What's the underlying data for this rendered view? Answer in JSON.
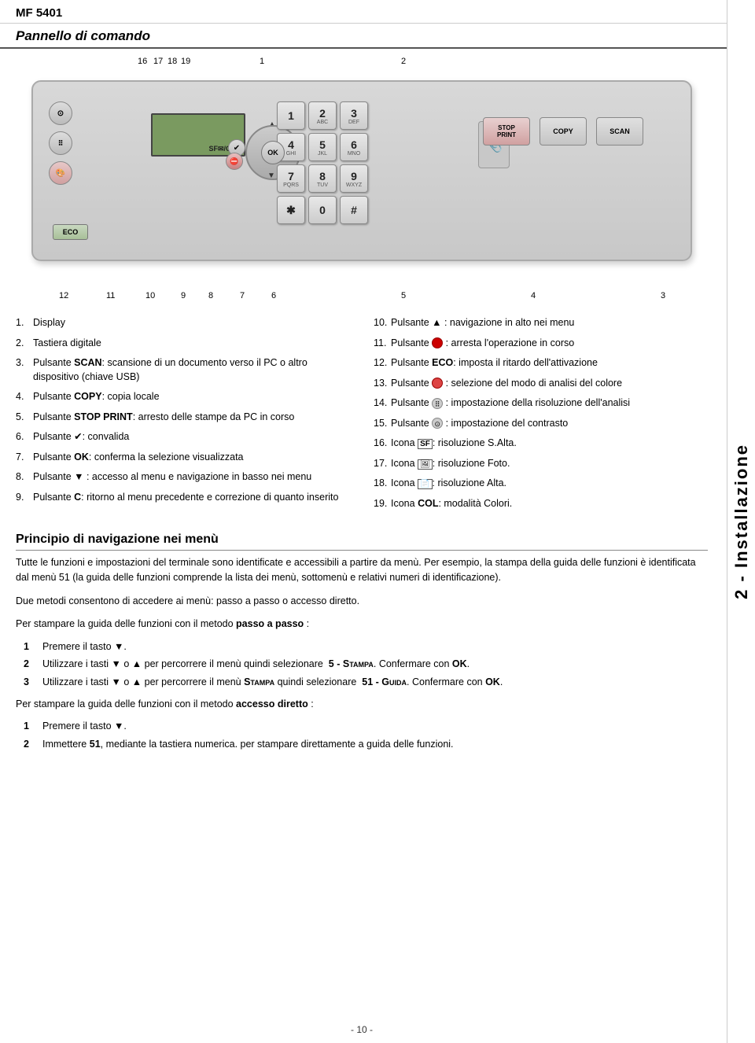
{
  "header": {
    "model": "MF 5401"
  },
  "side_label": {
    "text": "2 - Installazione"
  },
  "section1": {
    "title": "Pannello di comando"
  },
  "panel": {
    "position_numbers_top": [
      "16",
      "17",
      "18",
      "19",
      "1",
      "2"
    ],
    "position_numbers_bottom": [
      "12",
      "11",
      "10",
      "9",
      "8",
      "7",
      "6",
      "5",
      "4",
      "3"
    ],
    "lcd_text": "SF✉/COL",
    "keys": [
      {
        "label": "1",
        "sub": ""
      },
      {
        "label": "2",
        "sub": "ABC"
      },
      {
        "label": "3",
        "sub": "DEF"
      },
      {
        "label": "4",
        "sub": "GHI"
      },
      {
        "label": "5",
        "sub": "JKL"
      },
      {
        "label": "6",
        "sub": "MNO"
      },
      {
        "label": "7",
        "sub": "PQRS"
      },
      {
        "label": "8",
        "sub": "TUV"
      },
      {
        "label": "9",
        "sub": "WXYZ"
      },
      {
        "label": "✱",
        "sub": ""
      },
      {
        "label": "0",
        "sub": ""
      },
      {
        "label": "#",
        "sub": ""
      }
    ],
    "func_buttons": [
      {
        "label": "STOP\nPRINT",
        "type": "stop"
      },
      {
        "label": "COPY",
        "type": "normal"
      },
      {
        "label": "SCAN",
        "type": "normal"
      }
    ],
    "eco_label": "ECO"
  },
  "items_left": [
    {
      "num": "1.",
      "text": "Display"
    },
    {
      "num": "2.",
      "text": "Tastiera digitale"
    },
    {
      "num": "3.",
      "text": "Pulsante <b>SCAN</b>: scansione di un documento verso il PC o altro dispositivo (chiave USB)"
    },
    {
      "num": "4.",
      "text": "Pulsante <b>COPY</b>: copia locale"
    },
    {
      "num": "5.",
      "text": "Pulsante <b>STOP PRINT</b>: arresto delle stampe da PC in corso"
    },
    {
      "num": "6.",
      "text": "Pulsante ✔: convalida"
    },
    {
      "num": "7.",
      "text": "Pulsante <b>OK</b>: conferma la selezione visualizzata"
    },
    {
      "num": "8.",
      "text": "Pulsante ▼ : accesso al menu e navigazione in basso nei menu"
    },
    {
      "num": "9.",
      "text": "Pulsante <b>C</b>: ritorno al menu precedente e correzione di quanto inserito"
    }
  ],
  "items_right": [
    {
      "num": "10.",
      "text": "Pulsante ▲ : navigazione in alto nei menu"
    },
    {
      "num": "11.",
      "text": "Pulsante 🔴 : arresta l'operazione in corso"
    },
    {
      "num": "12.",
      "text": "Pulsante <b>ECO</b>: imposta il ritardo dell'attivazione"
    },
    {
      "num": "13.",
      "text": "Pulsante 🎨 : selezione del modo di analisi del colore"
    },
    {
      "num": "14.",
      "text": "Pulsante ⠿ : impostazione della risoluzione dell'analisi"
    },
    {
      "num": "15.",
      "text": "Pulsante ⊙ : impostazione del contrasto"
    },
    {
      "num": "16.",
      "text": "Icona 📷: risoluzione S.Alta."
    },
    {
      "num": "17.",
      "text": "Icona 🖼: risoluzione Foto."
    },
    {
      "num": "18.",
      "text": "Icona 📄: risoluzione Alta."
    },
    {
      "num": "19.",
      "text": "Icona COL: modalità Colori."
    }
  ],
  "section2": {
    "title": "Principio di navigazione nei menù",
    "intro": "Tutte le funzioni e impostazioni del terminale sono identificate e accessibili a partire da menù. Per esempio, la stampa della guida delle funzioni è identificata dal menù 51 (la guida delle funzioni comprende la lista dei menù, sottomenù e relativi numeri di identificazione).",
    "para2": "Due metodi consentono di accedere ai menù: passo a passo o accesso diretto.",
    "passo_intro": "Per stampare la guida delle funzioni con il metodo",
    "passo_bold": "passo a passo",
    "passo_colon": " :",
    "steps_passo": [
      {
        "num": "1",
        "text": "Premere il tasto ▼."
      },
      {
        "num": "2",
        "text": "Utilizzare i tasti ▼ o ▲ per percorrere il menù quindi selezionare  <b>5 - Stampa</b>. Confermare con <b>OK</b>."
      },
      {
        "num": "3",
        "text": "Utilizzare i tasti ▼ o ▲ per percorrere il menù <b>Stampa</b> quindi selezionare  <b>51 - Guida</b>. Confermare con <b>OK</b>."
      }
    ],
    "diretto_intro": "Per stampare la guida delle funzioni con il metodo",
    "diretto_bold": "accesso diretto",
    "diretto_colon": " :",
    "steps_diretto": [
      {
        "num": "1",
        "text": "Premere il tasto ▼."
      },
      {
        "num": "2",
        "text": "Immettere <b>51</b>, mediante la tastiera numerica. per stampare direttamente a guida delle funzioni."
      }
    ]
  },
  "footer": {
    "page": "- 10 -"
  }
}
